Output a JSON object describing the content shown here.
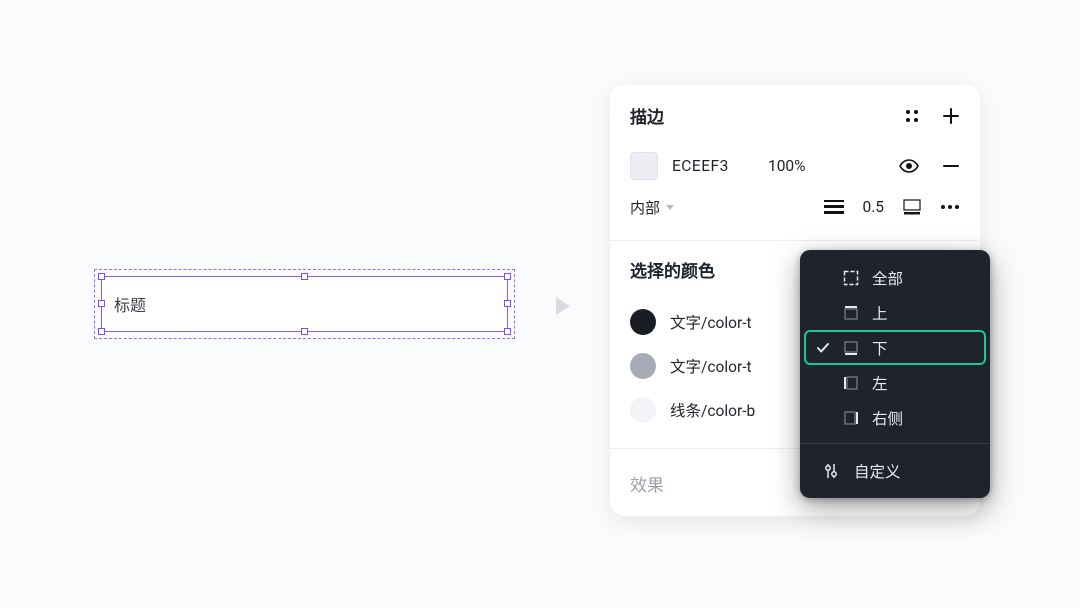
{
  "canvas": {
    "element_label": "标题"
  },
  "stroke_panel": {
    "title": "描边",
    "color_hex": "ECEEF3",
    "color_opacity": "100%",
    "position_label": "内部",
    "weight_value": "0.5"
  },
  "colors_section": {
    "title": "选择的颜色",
    "items": [
      {
        "label": "文字/color-t"
      },
      {
        "label": "文字/color-t"
      },
      {
        "label": "线条/color-b"
      }
    ]
  },
  "effects_section": {
    "title": "效果"
  },
  "border_side_menu": {
    "options": [
      {
        "label": "全部",
        "selected": false
      },
      {
        "label": "上",
        "selected": false
      },
      {
        "label": "下",
        "selected": true
      },
      {
        "label": "左",
        "selected": false
      },
      {
        "label": "右侧",
        "selected": false
      }
    ],
    "custom_label": "自定义"
  }
}
